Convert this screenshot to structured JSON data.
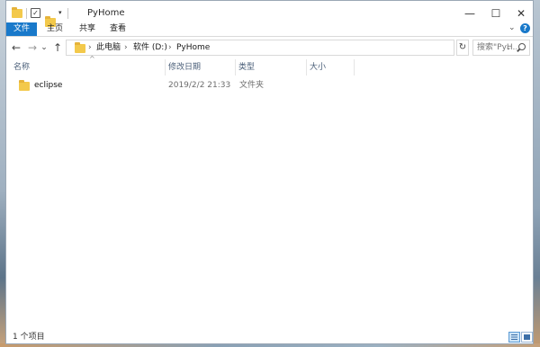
{
  "window": {
    "title": "PyHome",
    "controls": {
      "minimize": "—",
      "maximize": "☐",
      "close": "✕"
    }
  },
  "quick_access": {
    "dropdown": "▾"
  },
  "ribbon": {
    "tabs": [
      {
        "label": "文件",
        "active": true
      },
      {
        "label": "主页"
      },
      {
        "label": "共享"
      },
      {
        "label": "查看"
      }
    ],
    "collapse": "⌄",
    "help": "?"
  },
  "nav": {
    "back": "←",
    "forward": "→",
    "recent": "⌄",
    "up": "↑"
  },
  "address": {
    "crumbs": [
      "此电脑",
      "软件 (D:)",
      "PyHome"
    ],
    "separator": "›",
    "dropdown": "⌄",
    "refresh": "↻"
  },
  "search": {
    "placeholder": "搜索\"PyH..."
  },
  "columns": {
    "name": "名称",
    "modified": "修改日期",
    "type": "类型",
    "size": "大小",
    "sort_indicator": "^"
  },
  "files": [
    {
      "name": "eclipse",
      "modified": "2019/2/2 21:33",
      "type": "文件夹",
      "size": ""
    }
  ],
  "status": {
    "count": "1 个项目"
  },
  "colors": {
    "accent": "#1979ca",
    "folder": "#f3c94b"
  }
}
